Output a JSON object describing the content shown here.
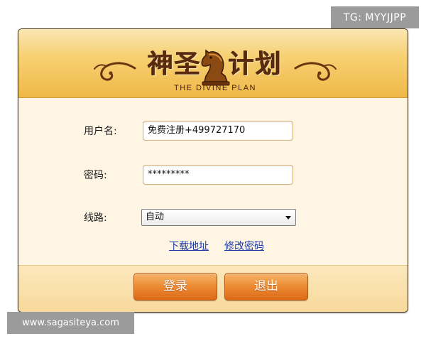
{
  "overlay": {
    "tag": "TG: MYYJJPP",
    "site": "www.sagasiteya.com"
  },
  "logo": {
    "cn_left": "神圣",
    "cn_right": "计划",
    "en": "THE DIVINE PLAN"
  },
  "form": {
    "username_label": "用户名:",
    "username_value": "免费注册+499727170",
    "password_label": "密码:",
    "password_value": "*********",
    "route_label": "线路:",
    "route_value": "自动"
  },
  "links": {
    "download": "下载地址",
    "change_password": "修改密码"
  },
  "buttons": {
    "login": "登录",
    "exit": "退出"
  },
  "colors": {
    "banner_gold": "#f6cf6f",
    "form_background": "#fef5e4",
    "button_orange": "#ec8a32",
    "link_blue": "#1a3aa8",
    "logo_brown": "#5a2a10"
  },
  "icons": {
    "logo_emblem": "chess-knight-icon",
    "select_arrow": "chevron-down-icon"
  }
}
